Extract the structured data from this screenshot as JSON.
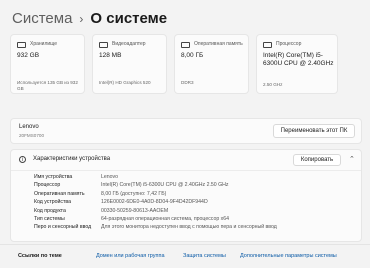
{
  "breadcrumb": {
    "parent": "Система",
    "separator": "›",
    "current": "О системе"
  },
  "cards": [
    {
      "caption": "Хранилище",
      "value": "932 GB",
      "sub": "Используется 135 GB из 932 GB",
      "icon": "storage-icon"
    },
    {
      "caption": "Видеоадаптер",
      "value": "128 MB",
      "sub": "Intel(R) HD Graphics 520",
      "icon": "display-icon"
    },
    {
      "caption": "Оперативная память",
      "value": "8,00 ГБ",
      "sub": "DDR3",
      "icon": "memory-icon"
    },
    {
      "caption": "Процессор",
      "value": "Intel(R) Core(TM) i5-6300U CPU @ 2.40GHz",
      "sub": "2.50 GHz",
      "icon": "processor-icon"
    }
  ],
  "device": {
    "name": "Lenovo",
    "model": "20FMS0700",
    "rename_label": "Переименовать этот ПК"
  },
  "specs": {
    "title": "Характеристики устройства",
    "copy_label": "Копировать",
    "rows": [
      {
        "key": "Имя устройства",
        "value": "Lenovo"
      },
      {
        "key": "Процессор",
        "value": "Intel(R) Core(TM) i5-6300U CPU @ 2.40GHz   2.50 GHz"
      },
      {
        "key": "Оперативная память",
        "value": "8,00 ГБ (доступно: 7,42 ГБ)"
      },
      {
        "key": "Код устройства",
        "value": "126E0002-6DE0-4A0D-8D04-9F4D42DF944D"
      },
      {
        "key": "Код продукта",
        "value": "00330-50259-80613-AAOEM"
      },
      {
        "key": "Тип системы",
        "value": "64-разрядная операционная система, процессор x64"
      },
      {
        "key": "Перо и сенсорный ввод",
        "value": "Для этого монитора недоступен ввод с помощью пера и сенсорный ввод"
      }
    ]
  },
  "related": {
    "label": "Ссылки по теме",
    "links": [
      "Домен или рабочая группа",
      "Защита системы",
      "Дополнительные параметры системы"
    ]
  }
}
